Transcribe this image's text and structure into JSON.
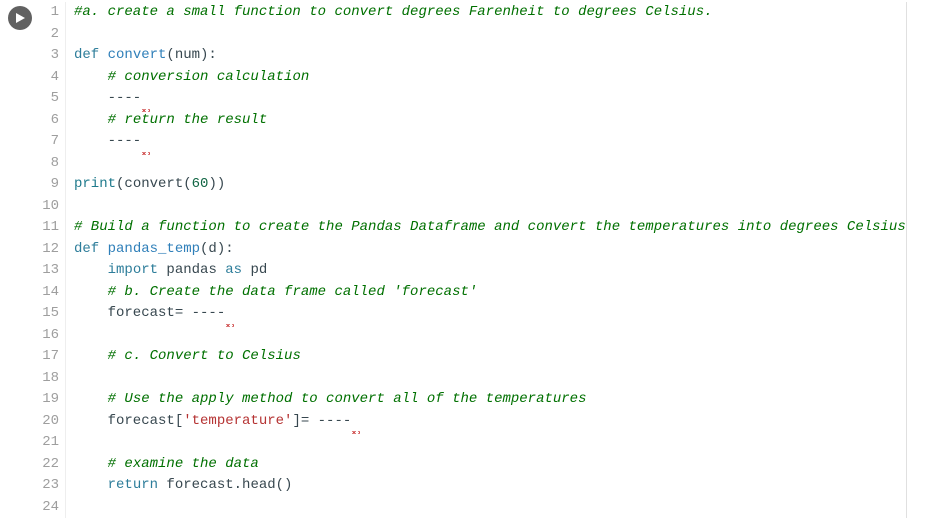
{
  "cell": {
    "run_icon": "play",
    "lines": [
      {
        "n": 1,
        "tokens": [
          {
            "t": "#a. create a small function to convert degrees Farenheit to degrees Celsius.",
            "cls": "c-comment"
          }
        ]
      },
      {
        "n": 2,
        "tokens": []
      },
      {
        "n": 3,
        "tokens": [
          {
            "t": "def ",
            "cls": "c-keyword"
          },
          {
            "t": "convert",
            "cls": "c-func"
          },
          {
            "t": "(num):",
            "cls": "c-default"
          }
        ]
      },
      {
        "n": 4,
        "tokens": [
          {
            "t": "    ",
            "cls": "c-default"
          },
          {
            "t": "# conversion calculation",
            "cls": "c-comment"
          }
        ]
      },
      {
        "n": 5,
        "tokens": [
          {
            "t": "    ----",
            "cls": "c-default"
          },
          {
            "t": " ",
            "cls": "c-default",
            "squiggle": true
          }
        ]
      },
      {
        "n": 6,
        "tokens": [
          {
            "t": "    ",
            "cls": "c-default"
          },
          {
            "t": "# return the result",
            "cls": "c-comment"
          }
        ]
      },
      {
        "n": 7,
        "tokens": [
          {
            "t": "    ----",
            "cls": "c-default"
          },
          {
            "t": " ",
            "cls": "c-default",
            "squiggle": true
          }
        ]
      },
      {
        "n": 8,
        "tokens": []
      },
      {
        "n": 9,
        "tokens": [
          {
            "t": "print",
            "cls": "c-builtin"
          },
          {
            "t": "(convert(",
            "cls": "c-default"
          },
          {
            "t": "60",
            "cls": "c-num"
          },
          {
            "t": "))",
            "cls": "c-default"
          }
        ]
      },
      {
        "n": 10,
        "tokens": []
      },
      {
        "n": 11,
        "tokens": [
          {
            "t": "# Build a function to create the Pandas Dataframe and convert the temperatures into degrees Celsius",
            "cls": "c-comment"
          }
        ]
      },
      {
        "n": 12,
        "tokens": [
          {
            "t": "def ",
            "cls": "c-keyword"
          },
          {
            "t": "pandas_temp",
            "cls": "c-func"
          },
          {
            "t": "(d):",
            "cls": "c-default"
          }
        ]
      },
      {
        "n": 13,
        "tokens": [
          {
            "t": "    ",
            "cls": "c-default"
          },
          {
            "t": "import",
            "cls": "c-keyword"
          },
          {
            "t": " pandas ",
            "cls": "c-default"
          },
          {
            "t": "as",
            "cls": "c-keyword"
          },
          {
            "t": " pd",
            "cls": "c-default"
          }
        ]
      },
      {
        "n": 14,
        "tokens": [
          {
            "t": "    ",
            "cls": "c-default"
          },
          {
            "t": "# b. Create the data frame called 'forecast'",
            "cls": "c-comment"
          }
        ]
      },
      {
        "n": 15,
        "tokens": [
          {
            "t": "    forecast= ----",
            "cls": "c-default"
          },
          {
            "t": " ",
            "cls": "c-default",
            "squiggle": true
          }
        ]
      },
      {
        "n": 16,
        "tokens": []
      },
      {
        "n": 17,
        "tokens": [
          {
            "t": "    ",
            "cls": "c-default"
          },
          {
            "t": "# c. Convert to Celsius",
            "cls": "c-comment"
          }
        ]
      },
      {
        "n": 18,
        "tokens": []
      },
      {
        "n": 19,
        "tokens": [
          {
            "t": "    ",
            "cls": "c-default"
          },
          {
            "t": "# Use the apply method to convert all of the temperatures",
            "cls": "c-comment"
          }
        ]
      },
      {
        "n": 20,
        "tokens": [
          {
            "t": "    forecast[",
            "cls": "c-default"
          },
          {
            "t": "'temperature'",
            "cls": "c-str"
          },
          {
            "t": "]= ----",
            "cls": "c-default"
          },
          {
            "t": " ",
            "cls": "c-default",
            "squiggle": true
          }
        ]
      },
      {
        "n": 21,
        "tokens": []
      },
      {
        "n": 22,
        "tokens": [
          {
            "t": "    ",
            "cls": "c-default"
          },
          {
            "t": "# examine the data",
            "cls": "c-comment"
          }
        ]
      },
      {
        "n": 23,
        "tokens": [
          {
            "t": "    ",
            "cls": "c-default"
          },
          {
            "t": "return",
            "cls": "c-keyword"
          },
          {
            "t": " forecast.head()",
            "cls": "c-default"
          }
        ]
      },
      {
        "n": 24,
        "tokens": []
      }
    ]
  }
}
